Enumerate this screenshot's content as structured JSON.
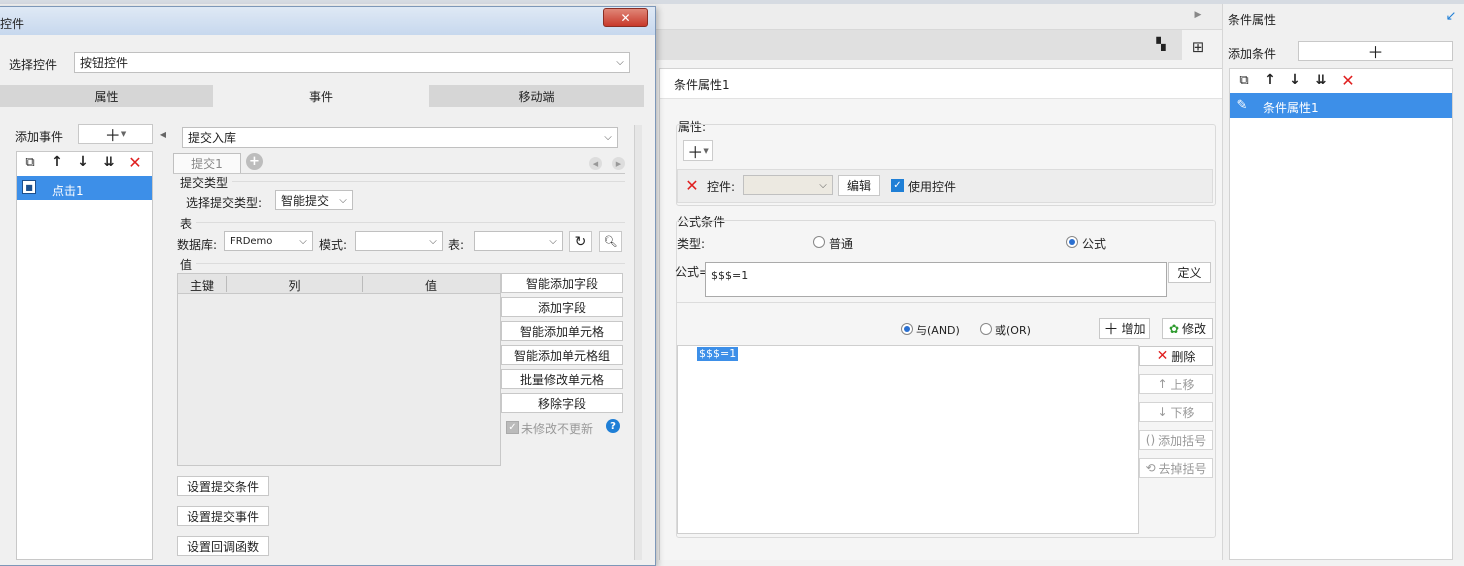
{
  "dialog": {
    "title": "控件",
    "close": "✕",
    "select_control_label": "选择控件",
    "select_control_value": "按钮控件",
    "tabs": [
      "属性",
      "事件",
      "移动端"
    ],
    "add_event_label": "添加事件",
    "events": [
      {
        "label": "点击1"
      }
    ],
    "event_type_value": "提交入库",
    "sub_tab": "提交1",
    "submit_type_section": "提交类型",
    "submit_type_label": "选择提交类型:",
    "submit_type_value": "智能提交",
    "table_section": "表",
    "db_label": "数据库:",
    "db_value": "FRDemo",
    "schema_label": "模式:",
    "schema_value": "",
    "table_label": "表:",
    "table_value": "",
    "value_section": "值",
    "value_columns": [
      "主键",
      "列",
      "值"
    ],
    "side_buttons": [
      "智能添加字段",
      "添加字段",
      "智能添加单元格",
      "智能添加单元格组",
      "批量修改单元格",
      "移除字段"
    ],
    "no_update_label": "未修改不更新",
    "bottom_buttons": [
      "设置提交条件",
      "设置提交事件",
      "设置回调函数"
    ]
  },
  "center": {
    "header": "条件属性1",
    "attr_section": "属性:",
    "control_label": "控件:",
    "control_value": "",
    "edit_button": "编辑",
    "use_control_label": "使用控件",
    "formula_section": "公式条件",
    "type_label": "类型:",
    "type_options": [
      "普通",
      "公式"
    ],
    "type_selected": "公式",
    "formula_label": "公式=",
    "formula_value": "$$$=1",
    "define_button": "定义",
    "logic_options": [
      "与(AND)",
      "或(OR)"
    ],
    "logic_selected": "与(AND)",
    "add_button": "增加",
    "modify_button": "修改",
    "conditions": [
      "$$$=1"
    ],
    "right_buttons": [
      "删除",
      "上移",
      "下移",
      "添加括号",
      "去掉括号"
    ]
  },
  "right": {
    "title": "条件属性",
    "add_condition_label": "添加条件",
    "items": [
      {
        "label": "条件属性1"
      }
    ]
  },
  "colors": {
    "selection": "#3d8fe8",
    "delete_red": "#e02020",
    "close_red": "#c8392b"
  }
}
